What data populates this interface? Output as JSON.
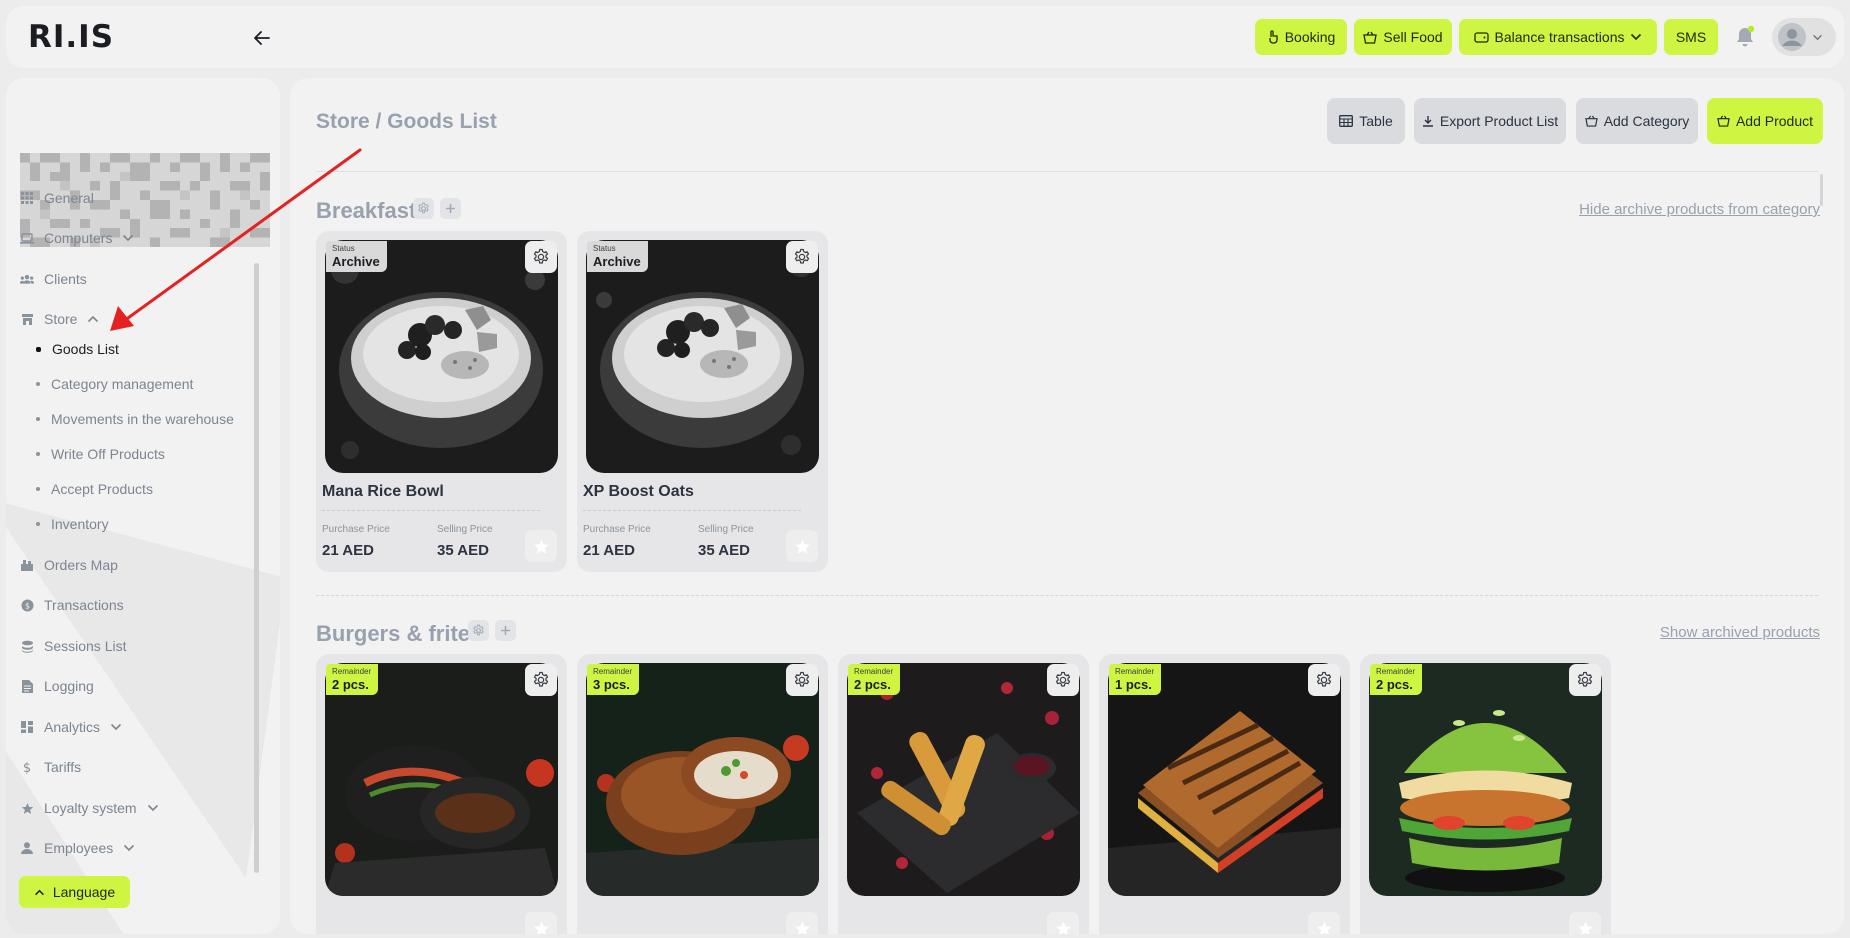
{
  "app": {
    "logo": "RI.IS"
  },
  "topbar": {
    "buttons": [
      {
        "label": "Booking",
        "icon": "hand-pointer-icon"
      },
      {
        "label": "Sell Food",
        "icon": "basket-icon"
      },
      {
        "label": "Balance transactions",
        "icon": "wallet-icon"
      },
      {
        "label": "SMS"
      }
    ]
  },
  "sidebar": {
    "items": [
      {
        "label": "General",
        "icon": "grid-icon"
      },
      {
        "label": "Computers",
        "icon": "laptop-icon",
        "expandable": true
      },
      {
        "label": "Clients",
        "icon": "users-icon"
      },
      {
        "label": "Store",
        "icon": "store-icon",
        "expanded": true
      }
    ],
    "store_sub": [
      {
        "label": "Goods List",
        "active": true
      },
      {
        "label": "Category management"
      },
      {
        "label": "Movements in the warehouse"
      },
      {
        "label": "Write Off Products"
      },
      {
        "label": "Accept Products"
      },
      {
        "label": "Inventory"
      }
    ],
    "items_after": [
      {
        "label": "Orders Map",
        "icon": "map-icon"
      },
      {
        "label": "Transactions",
        "icon": "coin-icon"
      },
      {
        "label": "Sessions List",
        "icon": "stack-icon"
      },
      {
        "label": "Logging",
        "icon": "document-icon"
      },
      {
        "label": "Analytics",
        "icon": "dashboard-icon",
        "expandable": true
      },
      {
        "label": "Tariffs",
        "icon": "dollar-icon"
      },
      {
        "label": "Loyalty system",
        "icon": "star-icon",
        "expandable": true
      },
      {
        "label": "Employees",
        "icon": "user-icon",
        "expandable": true
      }
    ],
    "language_label": "Language"
  },
  "main": {
    "title": "Store / Goods List",
    "actions": {
      "table": "Table",
      "export": "Export Product List",
      "add_category": "Add Category",
      "add_product": "Add Product"
    },
    "categories": [
      {
        "name": "Breakfast",
        "link": "Hide archive products from category",
        "products": [
          {
            "name": "Mana Rice Bowl",
            "badge_label": "Status",
            "badge_value": "Archive",
            "purchase_label": "Purchase Price",
            "purchase": "21 AED",
            "selling_label": "Selling Price",
            "selling": "35 AED"
          },
          {
            "name": "XP Boost Oats",
            "badge_label": "Status",
            "badge_value": "Archive",
            "purchase_label": "Purchase Price",
            "purchase": "21 AED",
            "selling_label": "Selling Price",
            "selling": "35 AED"
          }
        ]
      },
      {
        "name": "Burgers & frites",
        "link": "Show archived products",
        "products": [
          {
            "badge_label": "Remainder",
            "badge_value": "2 pcs."
          },
          {
            "badge_label": "Remainder",
            "badge_value": "3 pcs."
          },
          {
            "badge_label": "Remainder",
            "badge_value": "2 pcs."
          },
          {
            "badge_label": "Remainder",
            "badge_value": "1 pcs."
          },
          {
            "badge_label": "Remainder",
            "badge_value": "2 pcs."
          }
        ]
      }
    ]
  },
  "colors": {
    "accent": "#cdf542",
    "panel": "#f2f2f2",
    "background": "#ececec",
    "annotation_arrow": "#e52222"
  }
}
